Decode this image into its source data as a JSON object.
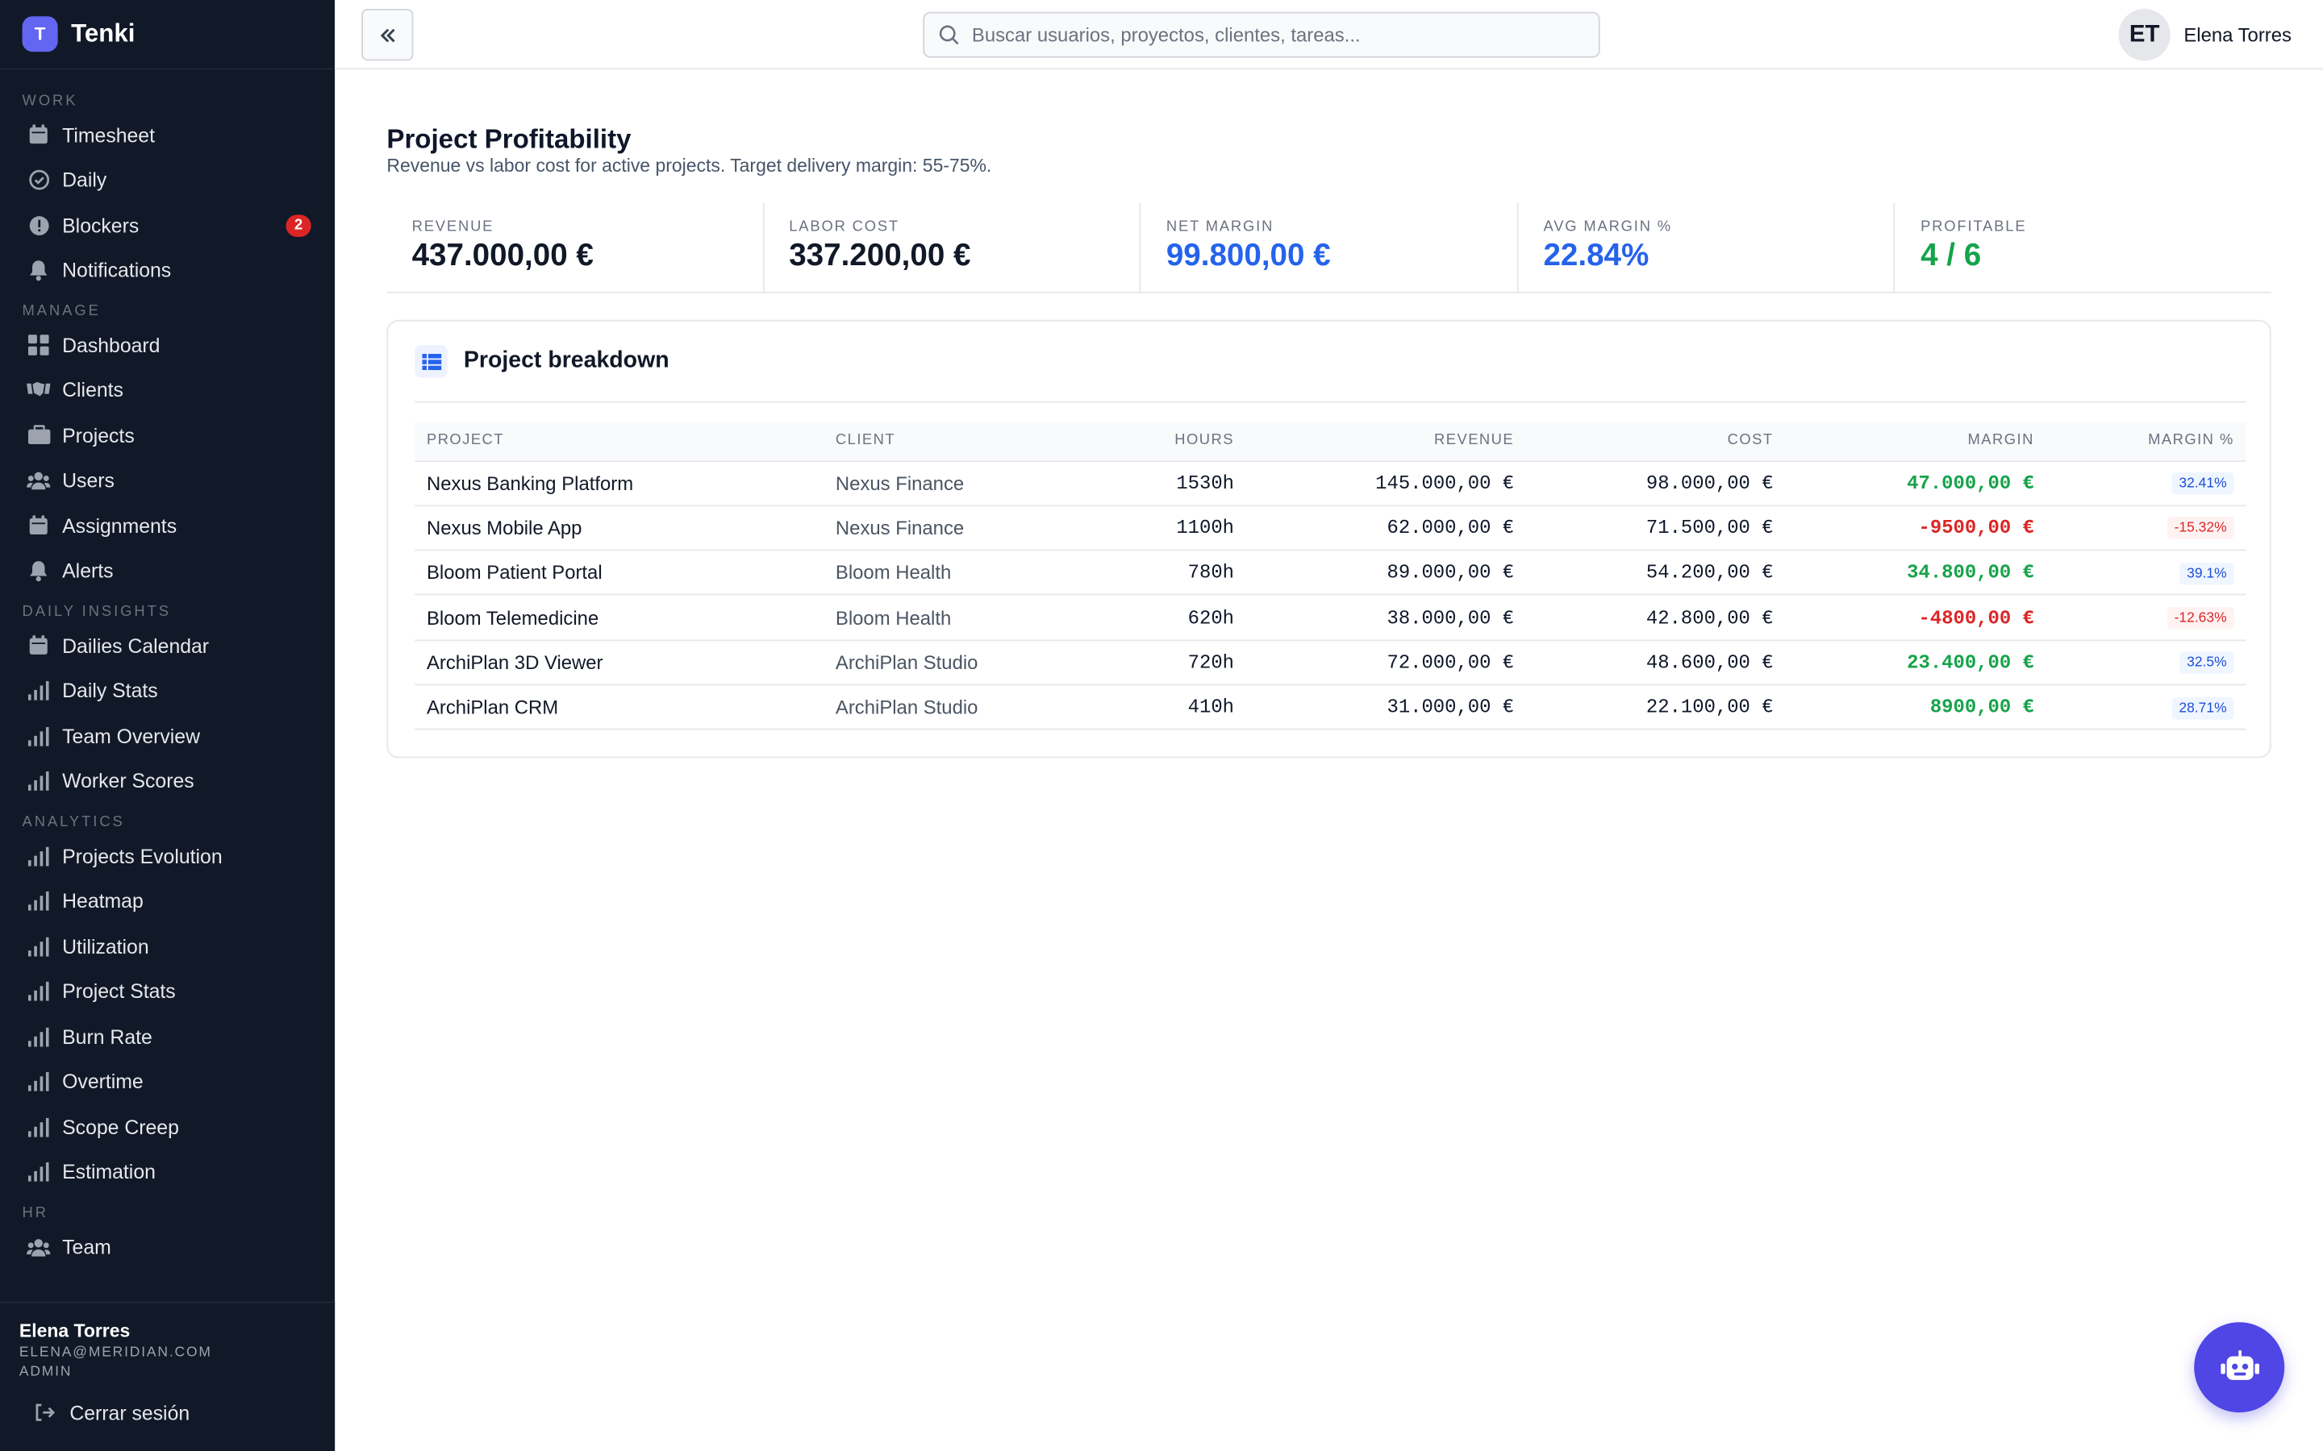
{
  "brand": {
    "logo_letter": "T",
    "name": "Tenki"
  },
  "sidebar": {
    "sections": [
      {
        "label": "WORK",
        "items": [
          {
            "label": "Timesheet",
            "icon": "calendar-icon"
          },
          {
            "label": "Daily",
            "icon": "check-circle-icon"
          },
          {
            "label": "Blockers",
            "icon": "alert-circle-icon",
            "badge": "2"
          },
          {
            "label": "Notifications",
            "icon": "bell-icon"
          }
        ]
      },
      {
        "label": "MANAGE",
        "items": [
          {
            "label": "Dashboard",
            "icon": "grid-icon"
          },
          {
            "label": "Clients",
            "icon": "handshake-icon"
          },
          {
            "label": "Projects",
            "icon": "briefcase-icon"
          },
          {
            "label": "Users",
            "icon": "users-icon"
          },
          {
            "label": "Assignments",
            "icon": "calendar-icon"
          },
          {
            "label": "Alerts",
            "icon": "bell-icon"
          }
        ]
      },
      {
        "label": "DAILY INSIGHTS",
        "items": [
          {
            "label": "Dailies Calendar",
            "icon": "calendar-icon"
          },
          {
            "label": "Daily Stats",
            "icon": "bar-chart-icon"
          },
          {
            "label": "Team Overview",
            "icon": "bar-chart-icon"
          },
          {
            "label": "Worker Scores",
            "icon": "bar-chart-icon"
          }
        ]
      },
      {
        "label": "ANALYTICS",
        "items": [
          {
            "label": "Projects Evolution",
            "icon": "bar-chart-icon"
          },
          {
            "label": "Heatmap",
            "icon": "bar-chart-icon"
          },
          {
            "label": "Utilization",
            "icon": "bar-chart-icon"
          },
          {
            "label": "Project Stats",
            "icon": "bar-chart-icon"
          },
          {
            "label": "Burn Rate",
            "icon": "bar-chart-icon"
          },
          {
            "label": "Overtime",
            "icon": "bar-chart-icon"
          },
          {
            "label": "Scope Creep",
            "icon": "bar-chart-icon"
          },
          {
            "label": "Estimation",
            "icon": "bar-chart-icon"
          }
        ]
      },
      {
        "label": "HR",
        "items": [
          {
            "label": "Team",
            "icon": "users-icon"
          }
        ]
      }
    ],
    "footer": {
      "name": "Elena Torres",
      "email": "ELENA@MERIDIAN.COM",
      "role": "ADMIN",
      "logout_label": "Cerrar sesión"
    }
  },
  "topbar": {
    "search_placeholder": "Buscar usuarios, proyectos, clientes, tareas...",
    "avatar_initials": "ET",
    "user_name": "Elena Torres"
  },
  "main": {
    "title": "Project Profitability",
    "subtitle": "Revenue vs labor cost for active projects. Target delivery margin: 55-75%.",
    "kpis": [
      {
        "label": "REVENUE",
        "value": "437.000,00 €",
        "color": "#111827"
      },
      {
        "label": "LABOR COST",
        "value": "337.200,00 €",
        "color": "#111827"
      },
      {
        "label": "NET MARGIN",
        "value": "99.800,00 €",
        "color": "#2563eb"
      },
      {
        "label": "AVG MARGIN %",
        "value": "22.84%",
        "color": "#2563eb"
      },
      {
        "label": "PROFITABLE",
        "value": "4 / 6",
        "color": "#16a34a"
      }
    ],
    "panel_title": "Project breakdown",
    "table": {
      "headers": [
        "PROJECT",
        "CLIENT",
        "HOURS",
        "REVENUE",
        "COST",
        "MARGIN",
        "MARGIN %"
      ],
      "rows": [
        {
          "project": "Nexus Banking Platform",
          "client": "Nexus Finance",
          "hours": "1530h",
          "revenue": "145.000,00 €",
          "cost": "98.000,00 €",
          "margin": "47.000,00 €",
          "margin_pct": "32.41%",
          "negative": false
        },
        {
          "project": "Nexus Mobile App",
          "client": "Nexus Finance",
          "hours": "1100h",
          "revenue": "62.000,00 €",
          "cost": "71.500,00 €",
          "margin": "-9500,00 €",
          "margin_pct": "-15.32%",
          "negative": true
        },
        {
          "project": "Bloom Patient Portal",
          "client": "Bloom Health",
          "hours": "780h",
          "revenue": "89.000,00 €",
          "cost": "54.200,00 €",
          "margin": "34.800,00 €",
          "margin_pct": "39.1%",
          "negative": false
        },
        {
          "project": "Bloom Telemedicine",
          "client": "Bloom Health",
          "hours": "620h",
          "revenue": "38.000,00 €",
          "cost": "42.800,00 €",
          "margin": "-4800,00 €",
          "margin_pct": "-12.63%",
          "negative": true
        },
        {
          "project": "ArchiPlan 3D Viewer",
          "client": "ArchiPlan Studio",
          "hours": "720h",
          "revenue": "72.000,00 €",
          "cost": "48.600,00 €",
          "margin": "23.400,00 €",
          "margin_pct": "32.5%",
          "negative": false
        },
        {
          "project": "ArchiPlan CRM",
          "client": "ArchiPlan Studio",
          "hours": "410h",
          "revenue": "31.000,00 €",
          "cost": "22.100,00 €",
          "margin": "8900,00 €",
          "margin_pct": "28.71%",
          "negative": false
        }
      ]
    }
  },
  "fab": {
    "icon": "robot-icon"
  },
  "colors": {
    "sidebar_bg": "#111827",
    "accent": "#4f46e5",
    "positive": "#16a34a",
    "negative": "#dc2626",
    "blue": "#2563eb"
  }
}
